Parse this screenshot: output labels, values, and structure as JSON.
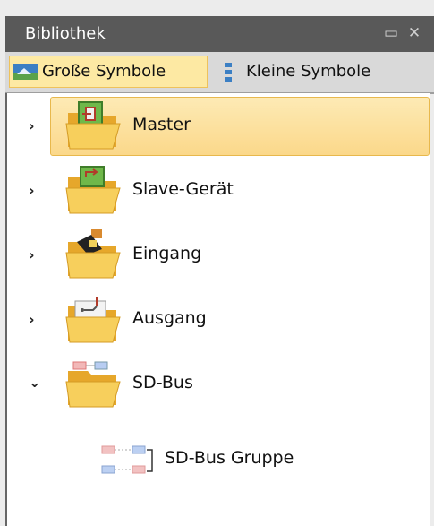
{
  "panel": {
    "title": "Bibliothek",
    "restore_glyph": "▭",
    "close_glyph": "✕"
  },
  "toolbar": {
    "large_icons_label": "Große Symbole",
    "small_icons_label": "Kleine Symbole"
  },
  "tree": {
    "items": [
      {
        "label": "Master",
        "expander": "›",
        "icon": "master-folder-icon",
        "selected": true
      },
      {
        "label": "Slave-Gerät",
        "expander": "›",
        "icon": "slave-folder-icon"
      },
      {
        "label": "Eingang",
        "expander": "›",
        "icon": "input-folder-icon"
      },
      {
        "label": "Ausgang",
        "expander": "›",
        "icon": "output-folder-icon"
      },
      {
        "label": "SD-Bus",
        "expander": "⌄",
        "icon": "sd-bus-folder-icon",
        "expanded": true
      }
    ],
    "children": [
      {
        "label": "SD-Bus Gruppe",
        "icon": "sd-bus-group-icon"
      }
    ]
  },
  "colors": {
    "header": "#595959",
    "selection": "#fbd88a",
    "selection_border": "#e8b84c",
    "folder": "#f5c242"
  }
}
